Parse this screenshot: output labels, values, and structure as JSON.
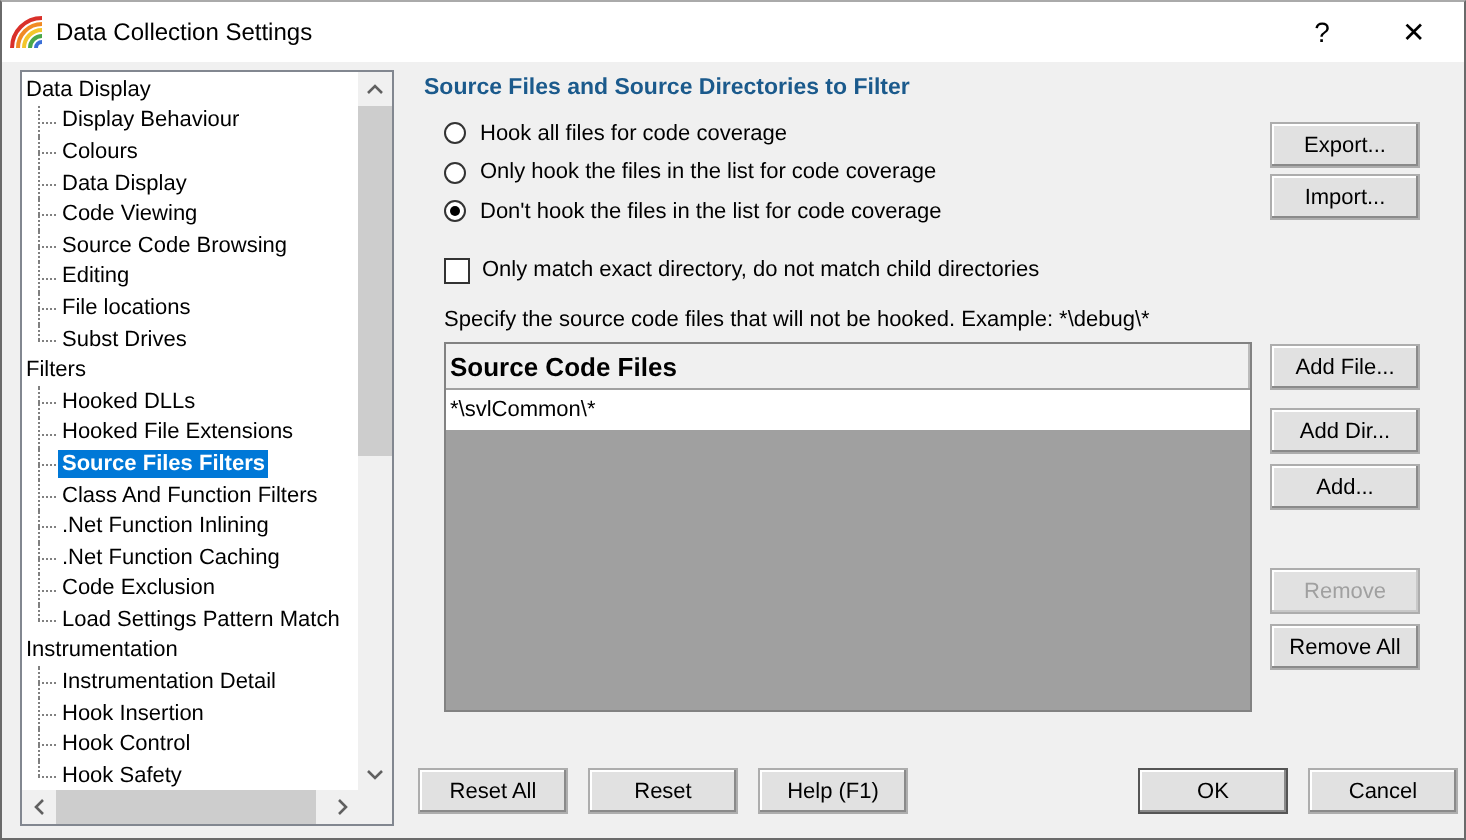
{
  "window": {
    "title": "Data Collection Settings",
    "help_glyph": "?",
    "close_glyph": "✕"
  },
  "tree": [
    {
      "label": "Data Display",
      "selected": false,
      "children": [
        {
          "label": "Display Behaviour",
          "selected": false
        },
        {
          "label": "Colours",
          "selected": false
        },
        {
          "label": "Data Display",
          "selected": false
        },
        {
          "label": "Code Viewing",
          "selected": false
        },
        {
          "label": "Source Code Browsing",
          "selected": false
        },
        {
          "label": "Editing",
          "selected": false
        },
        {
          "label": "File locations",
          "selected": false
        },
        {
          "label": "Subst Drives",
          "selected": false
        }
      ]
    },
    {
      "label": "Filters",
      "selected": false,
      "children": [
        {
          "label": "Hooked DLLs",
          "selected": false
        },
        {
          "label": "Hooked File Extensions",
          "selected": false
        },
        {
          "label": "Source Files Filters",
          "selected": true
        },
        {
          "label": "Class And Function Filters",
          "selected": false
        },
        {
          "label": ".Net Function Inlining",
          "selected": false
        },
        {
          "label": ".Net Function Caching",
          "selected": false
        },
        {
          "label": "Code Exclusion",
          "selected": false
        },
        {
          "label": "Load Settings Pattern Match",
          "selected": false
        }
      ]
    },
    {
      "label": "Instrumentation",
      "selected": false,
      "children": [
        {
          "label": "Instrumentation Detail",
          "selected": false
        },
        {
          "label": "Hook Insertion",
          "selected": false
        },
        {
          "label": "Hook Control",
          "selected": false
        },
        {
          "label": "Hook Safety",
          "selected": false
        }
      ]
    }
  ],
  "panel": {
    "heading": "Source Files and Source Directories to Filter",
    "radios": [
      {
        "label": "Hook all files for code coverage",
        "selected": false
      },
      {
        "label": "Only hook the files in the list for code coverage",
        "selected": false
      },
      {
        "label": "Don't hook the files in the list for code coverage",
        "selected": true
      }
    ],
    "top_buttons": [
      {
        "label": "Export...",
        "disabled": false
      },
      {
        "label": "Import...",
        "disabled": false
      }
    ],
    "checkbox": {
      "label": "Only match exact directory, do not match child directories",
      "checked": false
    },
    "instruction": "Specify the source code files that will not be hooked. Example: *\\debug\\*",
    "list": {
      "column": "Source Code Files",
      "rows": [
        "*\\svlCommon\\*"
      ]
    },
    "list_buttons": [
      {
        "label": "Add File...",
        "disabled": false
      },
      {
        "label": "Add Dir...",
        "disabled": false
      },
      {
        "label": "Add...",
        "disabled": false
      },
      {
        "label": "Remove",
        "disabled": true
      },
      {
        "label": "Remove All",
        "disabled": false
      }
    ]
  },
  "footer": {
    "left_buttons": [
      {
        "label": "Reset All",
        "disabled": false
      },
      {
        "label": "Reset",
        "disabled": false
      },
      {
        "label": "Help (F1)",
        "disabled": false
      }
    ],
    "right_buttons": [
      {
        "label": "OK",
        "disabled": false,
        "default": true
      },
      {
        "label": "Cancel",
        "disabled": false,
        "default": false
      }
    ]
  }
}
